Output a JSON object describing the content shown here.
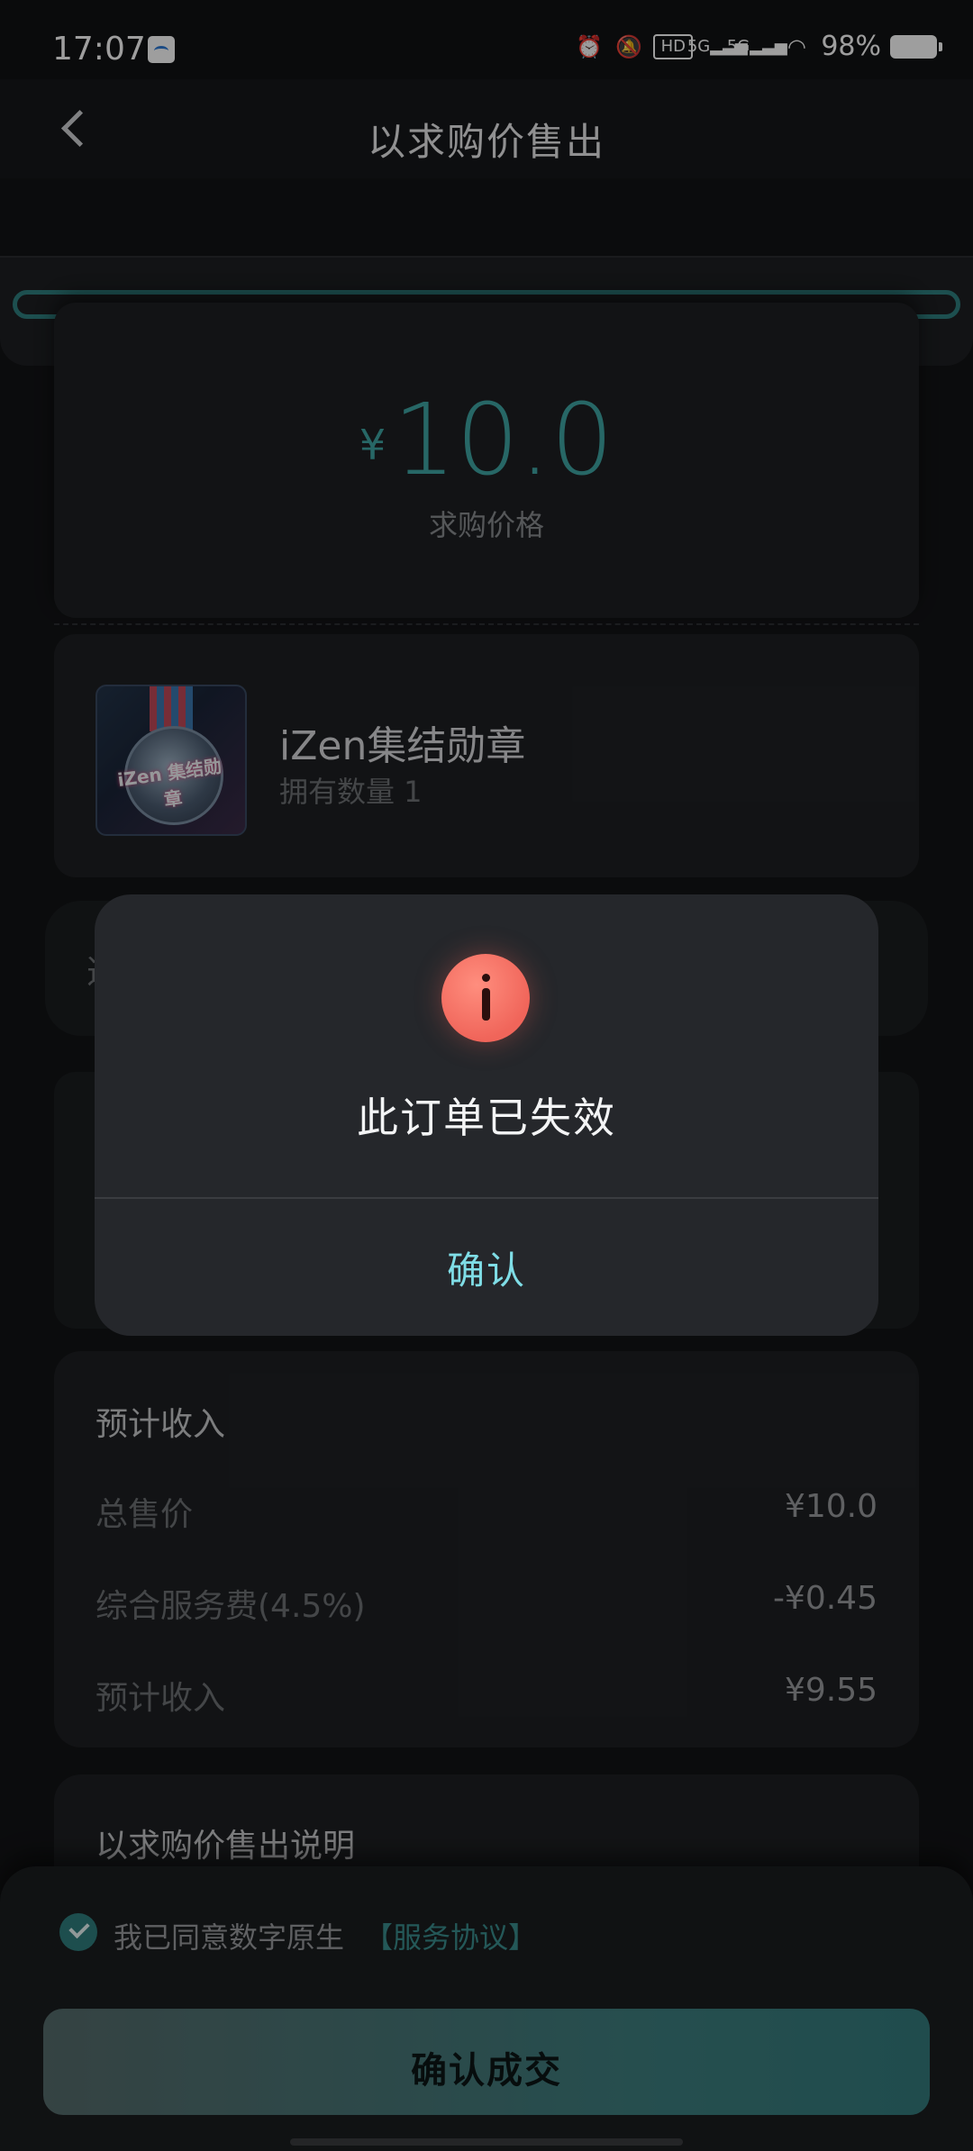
{
  "status_bar": {
    "time": "17:07",
    "battery": "98%",
    "icons": [
      "alarm-icon",
      "mute-icon",
      "hd-icon",
      "5g-signal-icon",
      "5g-signal-icon",
      "wifi-icon",
      "battery-icon"
    ]
  },
  "header": {
    "title": "以求购价售出"
  },
  "price_card": {
    "currency": "¥",
    "price": "10.0",
    "label": "求购价格",
    "accent_color": "#3fa7a5"
  },
  "item": {
    "name": "iZen集结勋章",
    "quantity_text": "拥有数量 1",
    "image_text": "iZen 集结勋章"
  },
  "income": {
    "title": "预计收入",
    "rows": [
      {
        "label": "总售价",
        "value": "¥10.0"
      },
      {
        "label": "综合服务费(4.5%)",
        "value": "-¥0.45"
      },
      {
        "label": "预计收入",
        "value": "¥9.55"
      }
    ]
  },
  "description": {
    "title": "以求购价售出说明"
  },
  "agreement": {
    "text": "我已同意数字原生",
    "link": "【服务协议】",
    "checked": true
  },
  "confirm_deal": {
    "label": "确认成交"
  },
  "modal": {
    "message": "此订单已失效",
    "confirm_label": "确认",
    "icon": "info-icon",
    "icon_color": "#f0655a",
    "confirm_color": "#7fdde6"
  }
}
